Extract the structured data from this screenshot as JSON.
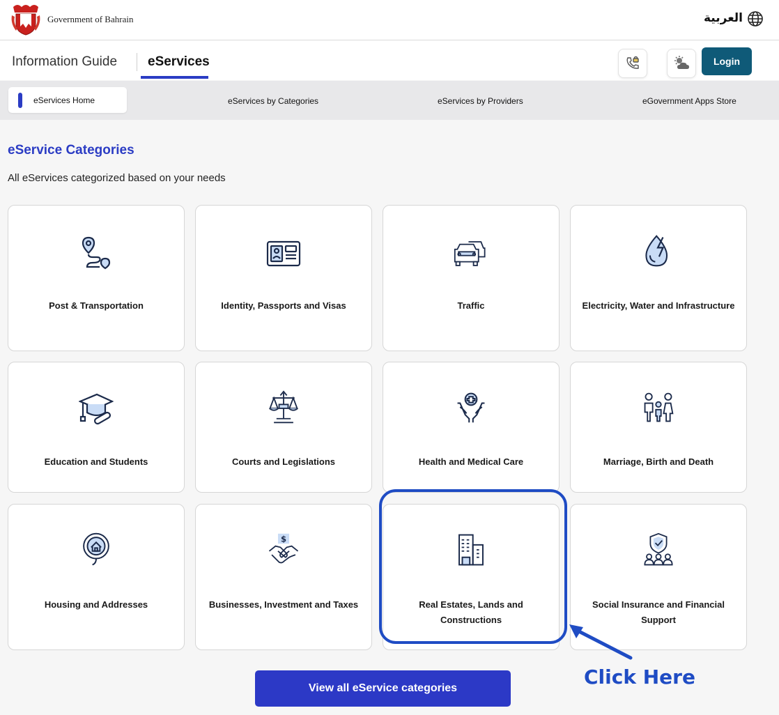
{
  "header": {
    "gov_name": "Government of Bahrain",
    "lang_switch": "العربية"
  },
  "nav": {
    "info_guide": "Information Guide",
    "eservices": "eServices",
    "login": "Login"
  },
  "subnav": {
    "home": "eServices Home",
    "by_categories": "eServices by Categories",
    "by_providers": "eServices by Providers",
    "apps_store": "eGovernment Apps Store"
  },
  "section": {
    "title": "eService Categories",
    "subtitle": "All eServices categorized based on your needs"
  },
  "categories": [
    {
      "label": "Post & Transportation",
      "icon": "route-pin-icon"
    },
    {
      "label": "Identity, Passports and Visas",
      "icon": "id-card-icon"
    },
    {
      "label": "Traffic",
      "icon": "cars-icon"
    },
    {
      "label": "Electricity, Water and Infrastructure",
      "icon": "water-bolt-icon"
    },
    {
      "label": "Education and Students",
      "icon": "graduation-cap-icon"
    },
    {
      "label": "Courts and Legislations",
      "icon": "scales-icon"
    },
    {
      "label": "Health and Medical Care",
      "icon": "care-hands-icon"
    },
    {
      "label": "Marriage, Birth and Death",
      "icon": "family-icon"
    },
    {
      "label": "Housing and Addresses",
      "icon": "home-pin-icon"
    },
    {
      "label": "Businesses, Investment and Taxes",
      "icon": "handshake-dollar-icon"
    },
    {
      "label": "Real Estates, Lands and Constructions",
      "icon": "buildings-icon"
    },
    {
      "label": "Social Insurance and Financial Support",
      "icon": "shield-people-icon"
    }
  ],
  "annotation": {
    "text": "Click Here",
    "color": "#1f4cc4"
  },
  "view_all": "View all eService categories",
  "colors": {
    "accent": "#2b3cc4",
    "login_bg": "#0f5a78",
    "icon_fill": "#c9dcf6",
    "icon_stroke": "#1b2a4a"
  }
}
